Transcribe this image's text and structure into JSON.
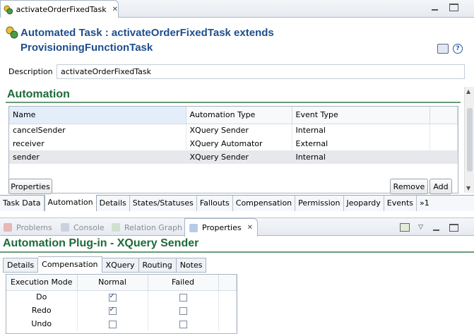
{
  "editor": {
    "tab_label": "activateOrderFixedTask",
    "close_glyph": "✕"
  },
  "header": {
    "title_line1": "Automated Task : activateOrderFixedTask extends",
    "title_line2": "ProvisioningFunctionTask",
    "help_glyph": "?"
  },
  "description": {
    "label": "Description",
    "value": "activateOrderFixedTask"
  },
  "automation": {
    "title": "Automation",
    "columns": [
      "Name",
      "Automation Type",
      "Event Type"
    ],
    "rows": [
      {
        "name": "cancelSender",
        "type": "XQuery Sender",
        "event": "Internal"
      },
      {
        "name": "receiver",
        "type": "XQuery Automator",
        "event": "External"
      },
      {
        "name": "sender",
        "type": "XQuery Sender",
        "event": "Internal"
      }
    ],
    "properties_button": "Properties",
    "remove_button": "Remove",
    "add_button": "Add"
  },
  "tabs": {
    "items": [
      "Task Data",
      "Automation",
      "Details",
      "States/Statuses",
      "Fallouts",
      "Compensation",
      "Permission",
      "Jeopardy",
      "Events"
    ],
    "active": "Automation",
    "overflow": "»1"
  },
  "views": {
    "problems": "Problems",
    "console": "Console",
    "relation_graph": "Relation Graph",
    "properties": "Properties",
    "close_glyph": "✕"
  },
  "plugin": {
    "title": "Automation Plug-in - XQuery Sender",
    "subtabs": [
      "Details",
      "Compensation",
      "XQuery",
      "Routing",
      "Notes"
    ],
    "active_subtab": "Compensation",
    "columns": [
      "Execution Mode",
      "Normal",
      "Failed"
    ],
    "rows": [
      {
        "mode": "Do",
        "normal": true,
        "failed": false
      },
      {
        "mode": "Redo",
        "normal": true,
        "failed": false
      },
      {
        "mode": "Undo",
        "normal": false,
        "failed": false
      }
    ]
  },
  "colors": {
    "title_blue": "#1f4e8c",
    "section_green": "#1e6b3a"
  }
}
